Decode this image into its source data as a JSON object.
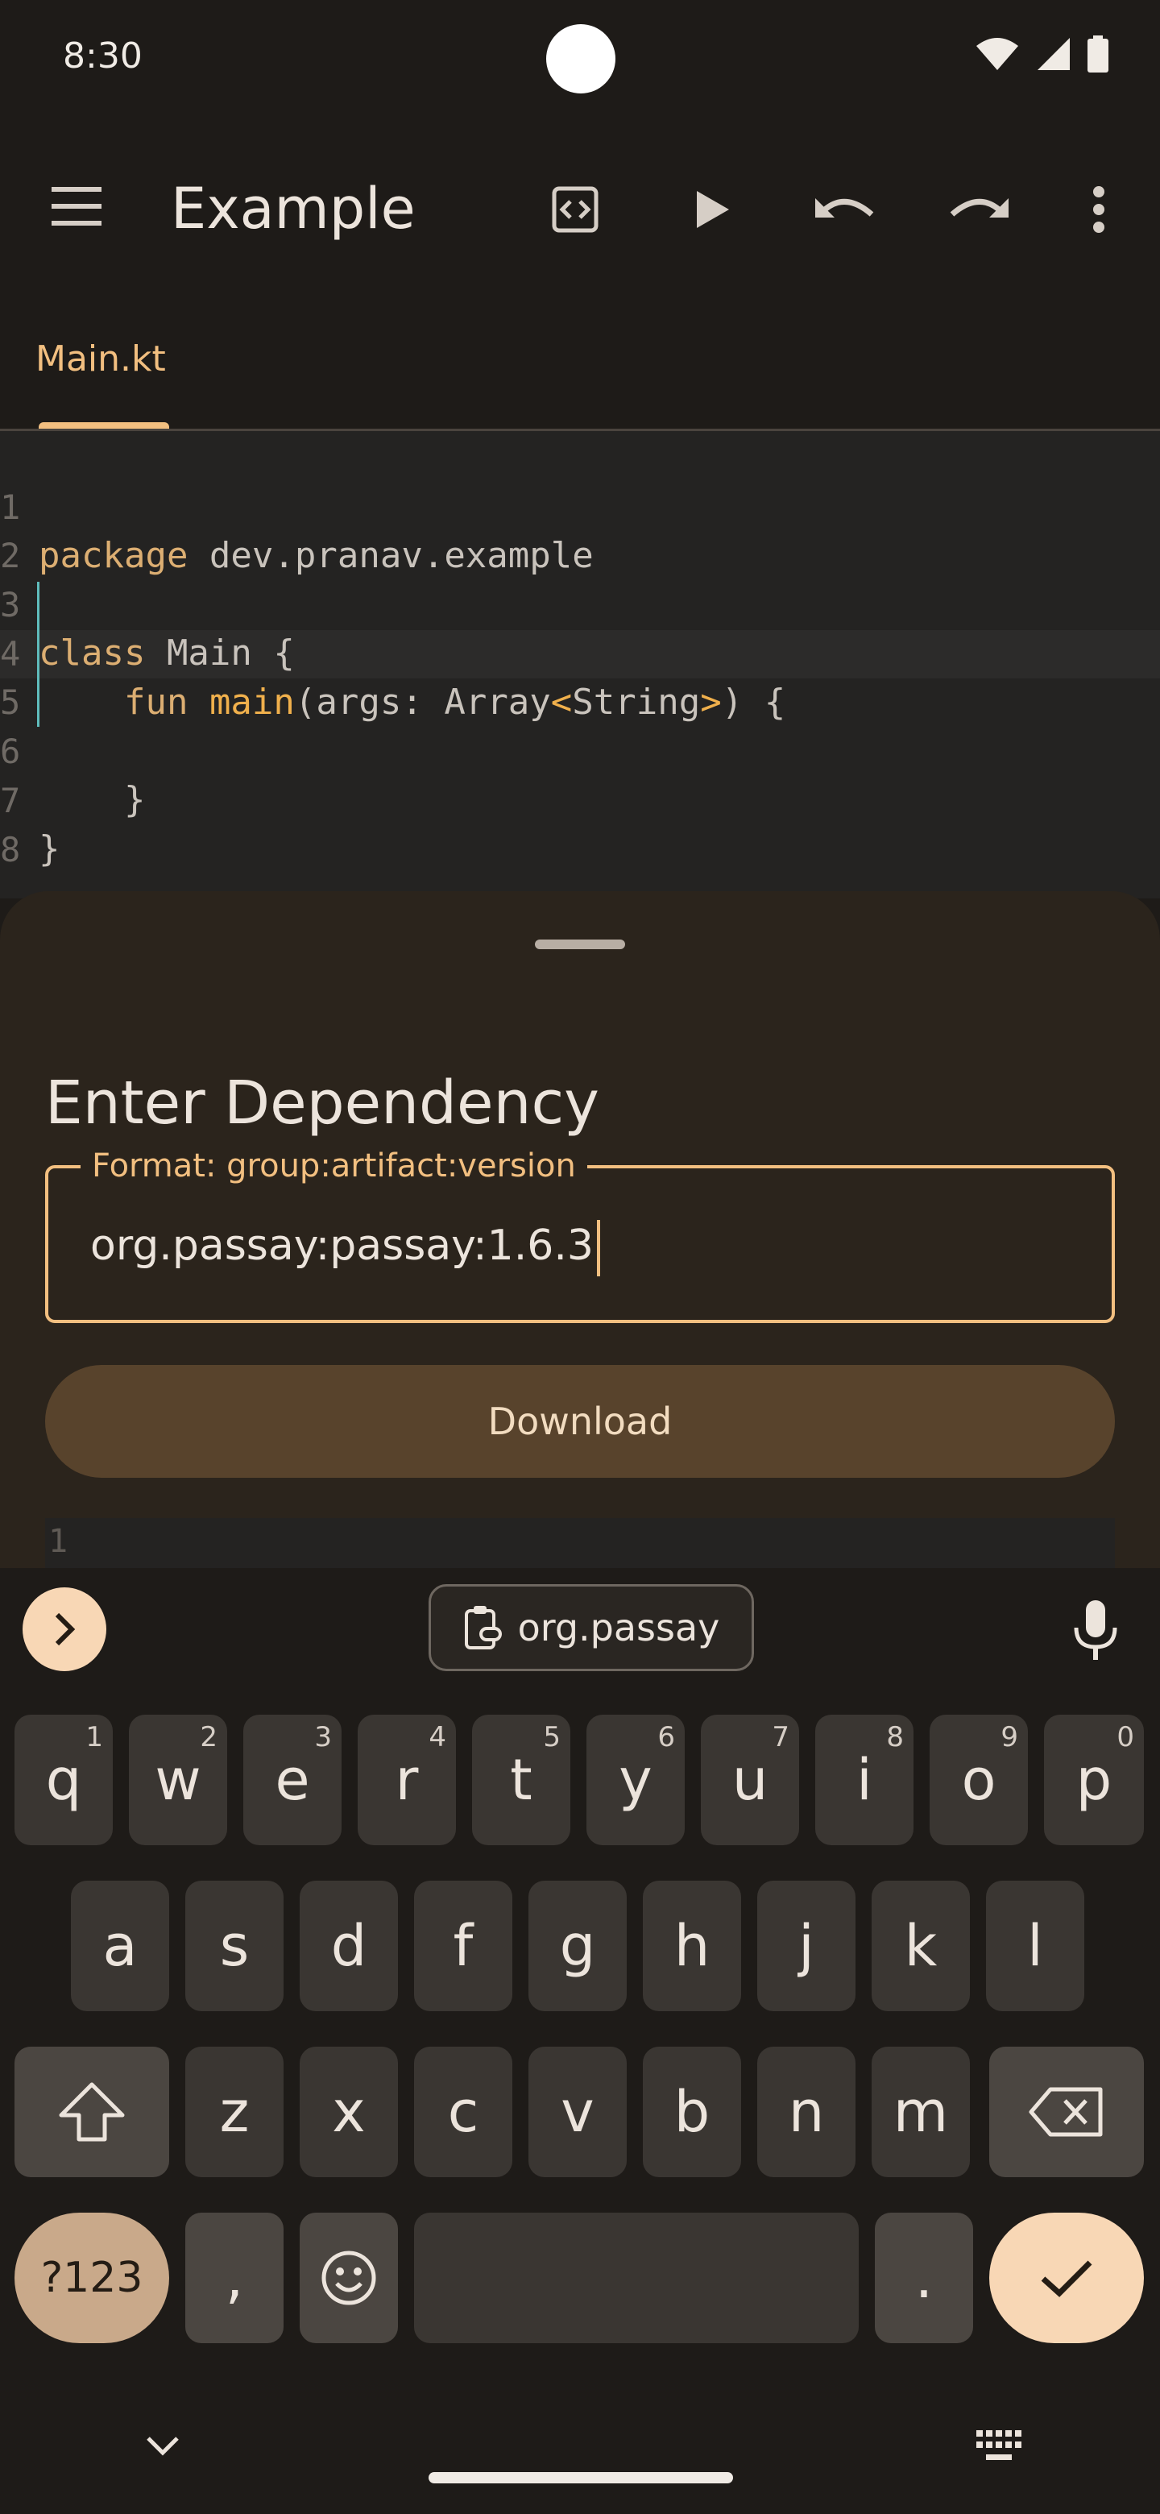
{
  "status_bar": {
    "time": "8:30"
  },
  "app_bar": {
    "title": "Example",
    "icons": [
      "menu-icon",
      "code-view-icon",
      "run-icon",
      "undo-icon",
      "redo-icon",
      "more-vert-icon"
    ]
  },
  "tabs": [
    {
      "label": "Main.kt",
      "selected": true
    }
  ],
  "editor": {
    "line_numbers": [
      "1",
      "2",
      "3",
      "4",
      "5",
      "6",
      "7",
      "8"
    ],
    "lines": [
      {
        "kw": "package",
        "rest": " dev.pranav.example"
      },
      {
        "text": ""
      },
      {
        "kw": "class",
        "rest": " Main {"
      },
      {
        "indent": "    ",
        "kw": "fun",
        "fn": " main",
        "p1": "(args: Array",
        "lt": "<",
        "ty": "String",
        "gt": ">",
        "p2": ") {"
      },
      {
        "text": ""
      },
      {
        "text": "    }"
      },
      {
        "text": "}"
      },
      {
        "text": ""
      }
    ],
    "current_line": 5
  },
  "sheet": {
    "title": "Enter Dependency",
    "field_label": "Format: group:artifact:version",
    "field_value": "org.passay:passay:1.6.3",
    "download_label": "Download",
    "peek_line_number": "1"
  },
  "keyboard": {
    "clipboard_suggestion": "org.passay",
    "row1": [
      {
        "k": "q",
        "h": "1"
      },
      {
        "k": "w",
        "h": "2"
      },
      {
        "k": "e",
        "h": "3"
      },
      {
        "k": "r",
        "h": "4"
      },
      {
        "k": "t",
        "h": "5"
      },
      {
        "k": "y",
        "h": "6"
      },
      {
        "k": "u",
        "h": "7"
      },
      {
        "k": "i",
        "h": "8"
      },
      {
        "k": "o",
        "h": "9"
      },
      {
        "k": "p",
        "h": "0"
      }
    ],
    "row2": [
      "a",
      "s",
      "d",
      "f",
      "g",
      "h",
      "j",
      "k",
      "l"
    ],
    "row3": [
      "z",
      "x",
      "c",
      "v",
      "b",
      "n",
      "m"
    ],
    "symbols_label": "?123",
    "comma": ",",
    "period": "."
  },
  "colors": {
    "accent": "#f2bf80",
    "sheet": "#2b241c",
    "button": "#58432c",
    "keyboard_bg": "#1e1b18"
  }
}
